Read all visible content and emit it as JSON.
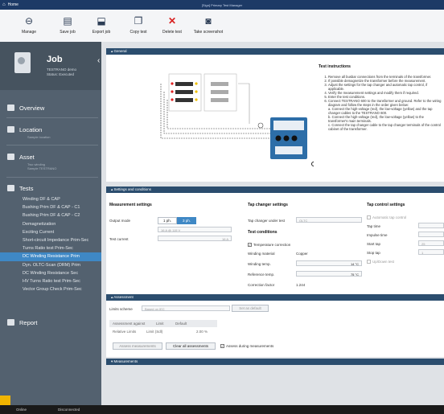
{
  "window": {
    "title": "Home",
    "center_title": "[Sign] Primary Test Manager"
  },
  "toolbar": {
    "buttons": [
      {
        "label": "Manage",
        "icon": "back-circle-icon"
      },
      {
        "label": "Save job",
        "icon": "save-icon"
      },
      {
        "label": "Export job",
        "icon": "export-icon"
      },
      {
        "label": "Copy test",
        "icon": "copy-icon"
      },
      {
        "label": "Delete test",
        "icon": "delete-icon"
      },
      {
        "label": "Take screenshot",
        "icon": "camera-icon"
      }
    ]
  },
  "sidebar": {
    "job_title": "Job",
    "job_line1": "TESTRANO demo",
    "job_line2": "Status: Executed",
    "overview": "Overview",
    "location": "Location",
    "location_sub": "Sample location",
    "asset": "Asset",
    "asset_sub1": "Two winding",
    "asset_sub2": "Sample TESTRANO",
    "tests_title": "Tests",
    "tests": [
      "Winding DF & CAP",
      "Bushing Prim DF & CAP - C1",
      "Bushing Prim DF & CAP - C2",
      "Demagnetization",
      "Exciting Current",
      "Short-circuit Impedance Prim-Sec",
      "Turns Ratio test Prim-Sec",
      "DC Winding Resistance Prim",
      "Dyn. OLTC-Scan (DRM) Prim",
      "DC Winding Resistance Sec",
      "HV Turns Ratio test Prim-Sec",
      "Vector Group Check Prim-Sec"
    ],
    "active_test_index": 7,
    "report": "Report"
  },
  "general": {
    "header": "General",
    "instructions_title": "Test instructions",
    "instructions": [
      "Remove all busbar connections from the terminals of the transformer.",
      "If possible demagnetize the transformer before the measurement.",
      "Adjust the settings for the tap changer and automatic tap control, if applicable.",
      "Verify the measurement settings and modify them if required.",
      "Enter the test conditions.",
      "Connect TESTRANO 600 to the transformer and ground. Refer to the wiring diagram and follow the steps in the order given below:",
      "a. Connect the high-voltage (red), the low-voltage (yellow) and the tap changer cables to the TESTRANO 600.",
      "b. Connect the high-voltage (red), the low-voltage (yellow) to the transformer's main terminals.",
      "c. Connect the tap changer cable to the tap changer terminals of the control cabinet of the transformer."
    ]
  },
  "settings": {
    "header": "Settings and conditions",
    "measurement_title": "Measurement settings",
    "output_mode_label": "Output mode",
    "output_modes": [
      "1 ph.",
      "3 ph."
    ],
    "range_value": "16 A @ 115 V",
    "test_current_label": "Test current",
    "test_current_value": "16 A",
    "tap_title": "Tap changer settings",
    "tap_under_test_label": "Tap changer under test",
    "tap_under_test_value": "OLTC",
    "conditions_title": "Test conditions",
    "temp_correction": "Temperature correction",
    "winding_material_label": "Winding material",
    "winding_material_value": "Copper",
    "winding_temp_label": "Winding temp.",
    "winding_temp_value": "14 °C",
    "ref_temp_label": "Reference temp.",
    "ref_temp_value": "75 °C",
    "correction_factor_label": "Correction factor",
    "correction_factor_value": "1.244",
    "tapcontrol_title": "Tap control settings",
    "auto_tap": "Automatic tap control",
    "tap_time_label": "Tap time",
    "impulse_time_label": "Impulse time",
    "start_tap_label": "Start tap",
    "start_tap_value": "25",
    "stop_tap_label": "Stop tap",
    "stop_tap_value": "1",
    "updown": "Up/Down test"
  },
  "assessment": {
    "header": "Assessment",
    "limits_scheme_label": "Limits scheme",
    "limits_scheme_value": "Based on IEC",
    "set_default": "Set as default",
    "col1": "Assessment against",
    "col2": "Limit",
    "col3": "Default",
    "row_label": "Relative Limits",
    "row_limit": "Limit (Sdl)",
    "row_default": "2.00 %",
    "assess_btn": "Assess measurements",
    "clear_btn": "Clear all assessments",
    "assess_during": "Assess during measurements"
  },
  "measurements": {
    "header": "Measurements"
  },
  "statusbar": {
    "left": "Online",
    "right": "Disconnected"
  }
}
